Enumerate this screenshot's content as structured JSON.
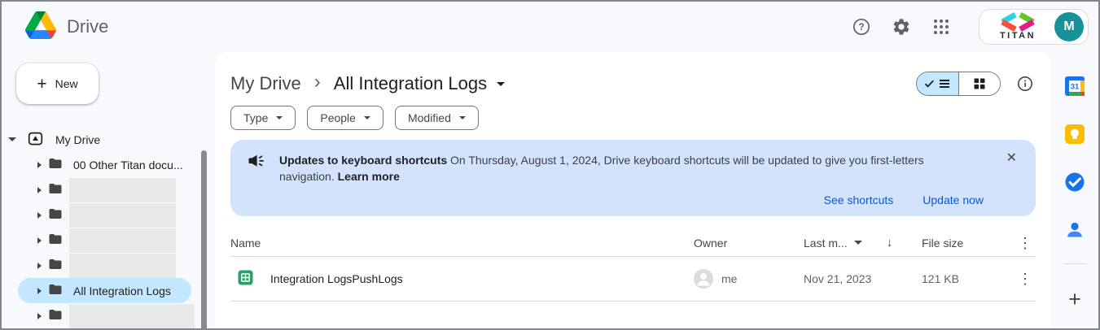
{
  "header": {
    "app_name": "Drive",
    "icons": [
      "help",
      "settings",
      "apps-grid"
    ],
    "account": {
      "brand": "TITAN",
      "avatar_initial": "M"
    }
  },
  "sidebar": {
    "new_label": "New",
    "root_label": "My Drive",
    "items": [
      {
        "label": "00 Other Titan docu...",
        "redacted": false,
        "selected": false
      },
      {
        "label": "",
        "redacted": true,
        "selected": false
      },
      {
        "label": "",
        "redacted": true,
        "selected": false
      },
      {
        "label": "",
        "redacted": true,
        "selected": false
      },
      {
        "label": "",
        "redacted": true,
        "selected": false
      },
      {
        "label": "All Integration Logs",
        "redacted": false,
        "selected": true
      },
      {
        "label": "",
        "redacted": true,
        "selected": false
      }
    ]
  },
  "main": {
    "breadcrumb": {
      "parent": "My Drive",
      "separator": "›",
      "current": "All Integration Logs"
    },
    "view_toggle": {
      "selected": "list"
    },
    "filters": {
      "type": "Type",
      "people": "People",
      "modified": "Modified"
    },
    "banner": {
      "title": "Updates to keyboard shortcuts",
      "body": "On Thursday, August 1, 2024, Drive keyboard shortcuts will be updated to give you first-letters navigation.",
      "link_label": "Learn more",
      "close": "✕",
      "actions": {
        "see_shortcuts": "See shortcuts",
        "update_now": "Update now"
      }
    },
    "table": {
      "headers": {
        "name": "Name",
        "owner": "Owner",
        "modified": "Last m...",
        "size": "File size"
      },
      "sort_arrow": "↓",
      "kebab": "⋮",
      "rows": [
        {
          "type": "google-sheet",
          "name": "Integration LogsPushLogs",
          "owner": "me",
          "modified": "Nov 21, 2023",
          "size": "121 KB"
        }
      ]
    }
  },
  "right_rail": {
    "items": [
      "calendar",
      "keep",
      "tasks",
      "contacts"
    ],
    "add": "+"
  },
  "colors": {
    "accent_blue": "#0b57d0",
    "selection_blue": "#c2e7ff",
    "banner_blue": "#d3e3fd",
    "avatar_teal": "#17929b",
    "sheet_green": "#21a464"
  }
}
